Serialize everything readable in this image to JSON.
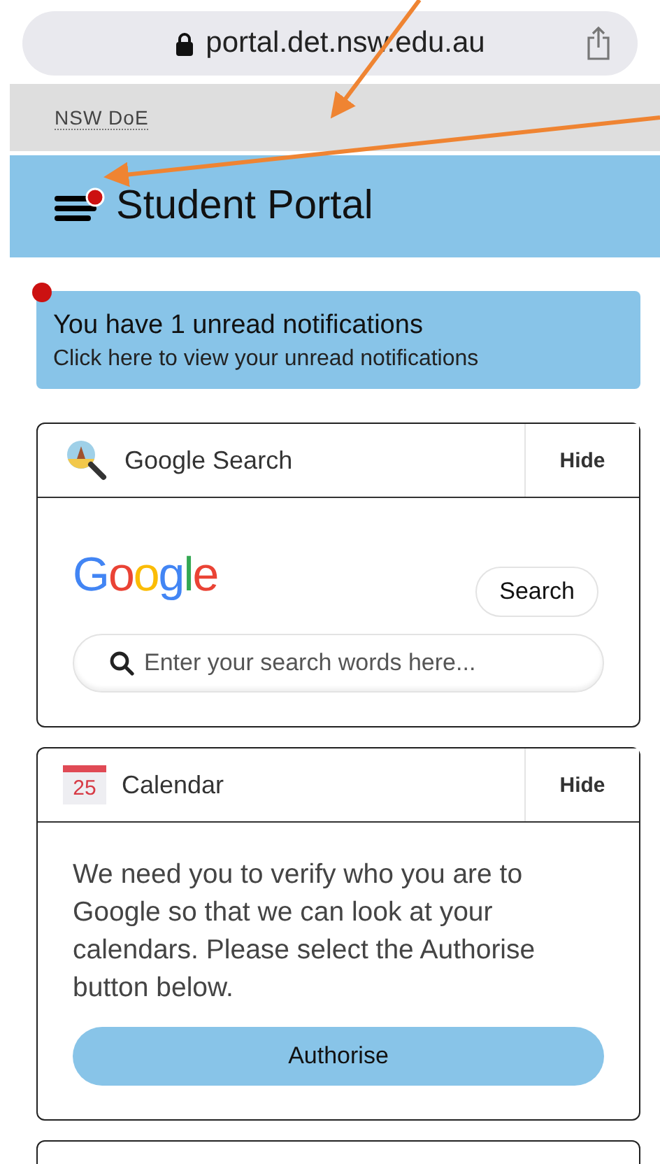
{
  "browser": {
    "url": "portal.det.nsw.edu.au"
  },
  "site_bar": {
    "label": "NSW DoE"
  },
  "header": {
    "title": "Student Portal",
    "menu_badge": true
  },
  "notification": {
    "badge": true,
    "title": "You have 1 unread notifications",
    "subtitle": "Click here to view your unread notifications"
  },
  "cards": [
    {
      "kind": "search",
      "title": "Google Search",
      "hide": "Hide",
      "logo": "Google",
      "button": "Search",
      "placeholder": "Enter your search words here..."
    },
    {
      "kind": "calendar",
      "title": "Calendar",
      "hide": "Hide",
      "icon_day": "25",
      "message": "We need you to verify who you are to Google so that we can look at your calendars. Please select the Authorise button below.",
      "button": "Authorise"
    },
    {
      "kind": "cutoff"
    }
  ]
}
